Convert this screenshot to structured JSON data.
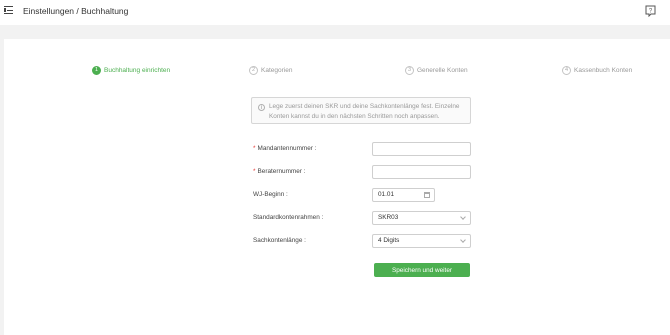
{
  "header": {
    "title": "Einstellungen / Buchhaltung",
    "menu_icon": "menu-collapse-icon",
    "help_icon": "help-question-icon"
  },
  "steps": [
    {
      "number": "1",
      "label": "Buchhaltung einrichten",
      "active": true
    },
    {
      "number": "2",
      "label": "Kategorien",
      "active": false
    },
    {
      "number": "3",
      "label": "Generelle Konten",
      "active": false
    },
    {
      "number": "4",
      "label": "Kassenbuch Konten",
      "active": false
    }
  ],
  "info": {
    "icon": "info-icon",
    "glyph": "i",
    "text": "Lege zuerst deinen SKR und deine Sachkontenlänge fest. Einzelne Konten kannst du in den nächsten Schritten noch anpassen."
  },
  "form": {
    "required_marker": "*",
    "mandant": {
      "label": "Mandantennummer :",
      "value": ""
    },
    "berater": {
      "label": "Beraternummer :",
      "value": ""
    },
    "wj_beginn": {
      "label": "WJ-Beginn :",
      "value": "01.01"
    },
    "standardkontenrahmen": {
      "label": "Standardkontenrahmen :",
      "value": "SKR03"
    },
    "sachkontenlaenge": {
      "label": "Sachkontenlänge :",
      "value": "4 Digits"
    },
    "save_label": "Speichern und weiter"
  },
  "colors": {
    "accent": "#4caf50",
    "required": "#e53935"
  }
}
